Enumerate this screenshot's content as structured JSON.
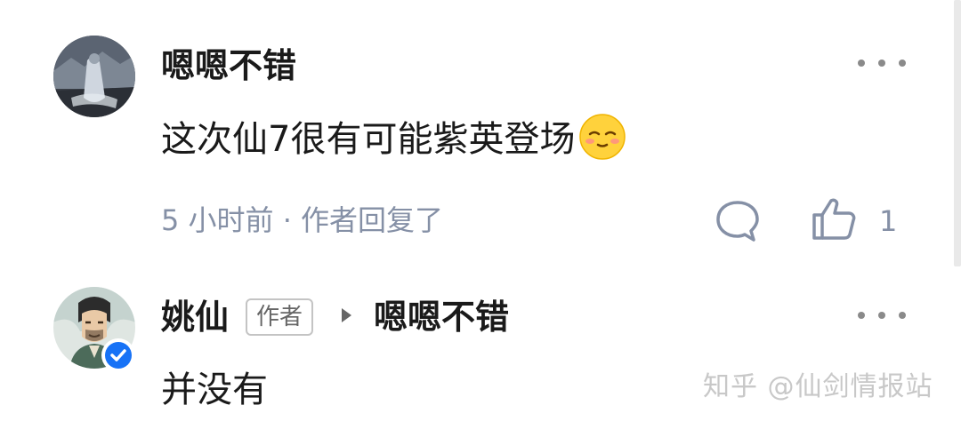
{
  "comments": [
    {
      "user_name": "嗯嗯不错",
      "avatar": "user-avatar-icon",
      "text": "这次仙7很有可能紫英登场",
      "emoji": "blush-smile-emoji-icon",
      "meta": "5 小时前 · 作者回复了",
      "like_count": "1",
      "actions": [
        "reply-icon",
        "like-icon",
        "more-icon"
      ]
    },
    {
      "user_name": "姚仙",
      "avatar": "author-avatar-icon",
      "verified": "verified-badge-icon",
      "author_tag": "作者",
      "reply_to": "嗯嗯不错",
      "text": "并没有",
      "actions": [
        "more-icon"
      ]
    }
  ],
  "watermark": "知乎 @仙剑情报站",
  "colors": {
    "text": "#1a1a1a",
    "meta": "#8590a6",
    "verified": "#1772f6",
    "tag_border": "#c4c4c4",
    "watermark": "#c8c8c8"
  }
}
